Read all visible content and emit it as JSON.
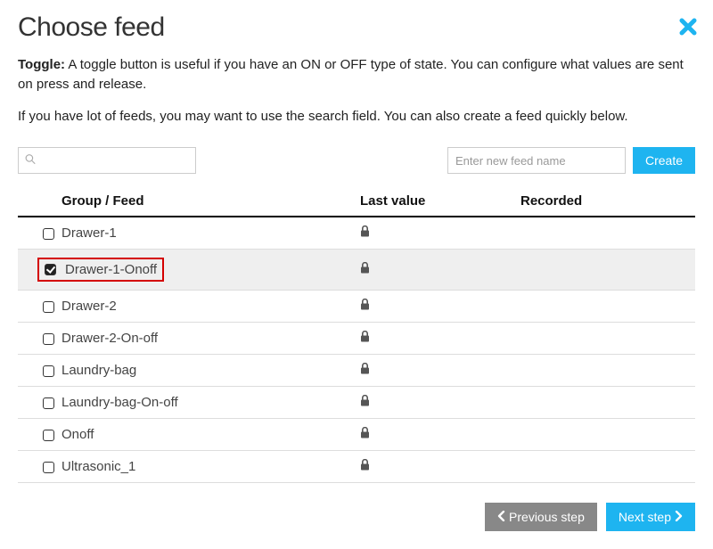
{
  "header": {
    "title": "Choose feed"
  },
  "description": {
    "bold": "Toggle:",
    "text": " A toggle button is useful if you have an ON or OFF type of state. You can configure what values are sent on press and release."
  },
  "hint_text": "If you have lot of feeds, you may want to use the search field. You can also create a feed quickly below.",
  "search": {
    "placeholder": ""
  },
  "new_feed": {
    "placeholder": "Enter new feed name",
    "create_label": "Create"
  },
  "table": {
    "columns": {
      "name": "Group / Feed",
      "last_value": "Last value",
      "recorded": "Recorded"
    },
    "rows": [
      {
        "name": "Drawer-1",
        "checked": false,
        "locked": true,
        "highlighted": false,
        "selected": false
      },
      {
        "name": "Drawer-1-Onoff",
        "checked": true,
        "locked": true,
        "highlighted": true,
        "selected": true
      },
      {
        "name": "Drawer-2",
        "checked": false,
        "locked": true,
        "highlighted": false,
        "selected": false
      },
      {
        "name": "Drawer-2-On-off",
        "checked": false,
        "locked": true,
        "highlighted": false,
        "selected": false
      },
      {
        "name": "Laundry-bag",
        "checked": false,
        "locked": true,
        "highlighted": false,
        "selected": false
      },
      {
        "name": "Laundry-bag-On-off",
        "checked": false,
        "locked": true,
        "highlighted": false,
        "selected": false
      },
      {
        "name": "Onoff",
        "checked": false,
        "locked": true,
        "highlighted": false,
        "selected": false
      },
      {
        "name": "Ultrasonic_1",
        "checked": false,
        "locked": true,
        "highlighted": false,
        "selected": false
      }
    ]
  },
  "footer": {
    "prev_label": "Previous step",
    "next_label": "Next step"
  },
  "icons": {
    "close": "✖",
    "lock": "🔒",
    "search": "🔍",
    "chevron_left": "❮",
    "chevron_right": "❯"
  }
}
